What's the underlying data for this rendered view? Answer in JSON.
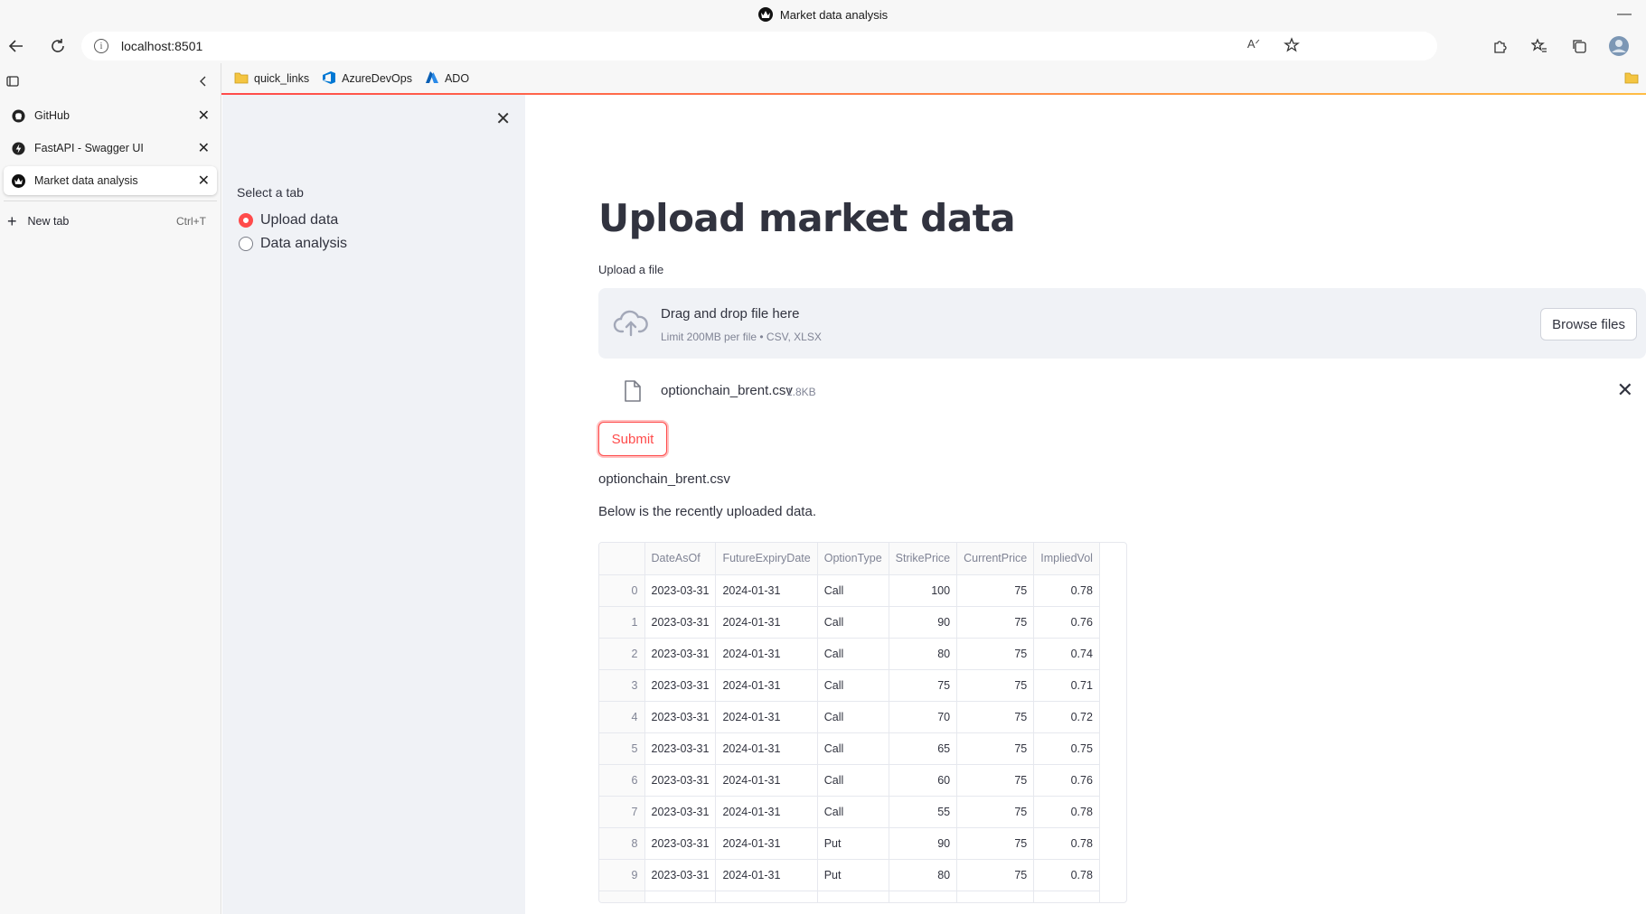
{
  "window": {
    "title": "Market data analysis"
  },
  "toolbar": {
    "url": "localhost:8501"
  },
  "bookmarks": [
    {
      "label": "quick_links",
      "icon": "folder-icon"
    },
    {
      "label": "AzureDevOps",
      "icon": "azure-devops-icon"
    },
    {
      "label": "ADO",
      "icon": "azure-icon"
    }
  ],
  "vtabs": {
    "tabs": [
      {
        "label": "GitHub",
        "icon": "github-icon",
        "active": false
      },
      {
        "label": "FastAPI - Swagger UI",
        "icon": "fastapi-icon",
        "active": false
      },
      {
        "label": "Market data analysis",
        "icon": "streamlit-icon",
        "active": true
      }
    ],
    "new_tab": {
      "label": "New tab",
      "shortcut": "Ctrl+T"
    }
  },
  "sidebar": {
    "group_label": "Select a tab",
    "options": [
      {
        "label": "Upload data",
        "selected": true
      },
      {
        "label": "Data analysis",
        "selected": false
      }
    ]
  },
  "main": {
    "title": "Upload market data",
    "uploader_label": "Upload a file",
    "dropzone": {
      "title": "Drag and drop file here",
      "limit": "Limit 200MB per file • CSV, XLSX",
      "browse_label": "Browse files"
    },
    "uploaded_file": {
      "name": "optionchain_brent.csv",
      "size": "1.8KB"
    },
    "submit_label": "Submit",
    "filename_text": "optionchain_brent.csv",
    "below_text": "Below is the recently uploaded data."
  },
  "table": {
    "columns": [
      "",
      "DateAsOf",
      "FutureExpiryDate",
      "OptionType",
      "StrikePrice",
      "CurrentPrice",
      "ImpliedVol"
    ],
    "rows": [
      [
        "0",
        "2023-03-31",
        "2024-01-31",
        "Call",
        "100",
        "75",
        "0.78"
      ],
      [
        "1",
        "2023-03-31",
        "2024-01-31",
        "Call",
        "90",
        "75",
        "0.76"
      ],
      [
        "2",
        "2023-03-31",
        "2024-01-31",
        "Call",
        "80",
        "75",
        "0.74"
      ],
      [
        "3",
        "2023-03-31",
        "2024-01-31",
        "Call",
        "75",
        "75",
        "0.71"
      ],
      [
        "4",
        "2023-03-31",
        "2024-01-31",
        "Call",
        "70",
        "75",
        "0.72"
      ],
      [
        "5",
        "2023-03-31",
        "2024-01-31",
        "Call",
        "65",
        "75",
        "0.75"
      ],
      [
        "6",
        "2023-03-31",
        "2024-01-31",
        "Call",
        "60",
        "75",
        "0.76"
      ],
      [
        "7",
        "2023-03-31",
        "2024-01-31",
        "Call",
        "55",
        "75",
        "0.78"
      ],
      [
        "8",
        "2023-03-31",
        "2024-01-31",
        "Put",
        "90",
        "75",
        "0.78"
      ],
      [
        "9",
        "2023-03-31",
        "2024-01-31",
        "Put",
        "80",
        "75",
        "0.78"
      ]
    ]
  },
  "colors": {
    "accent": "#ff4b4b",
    "sidebar_bg": "#f0f2f6",
    "text": "#31333f"
  }
}
